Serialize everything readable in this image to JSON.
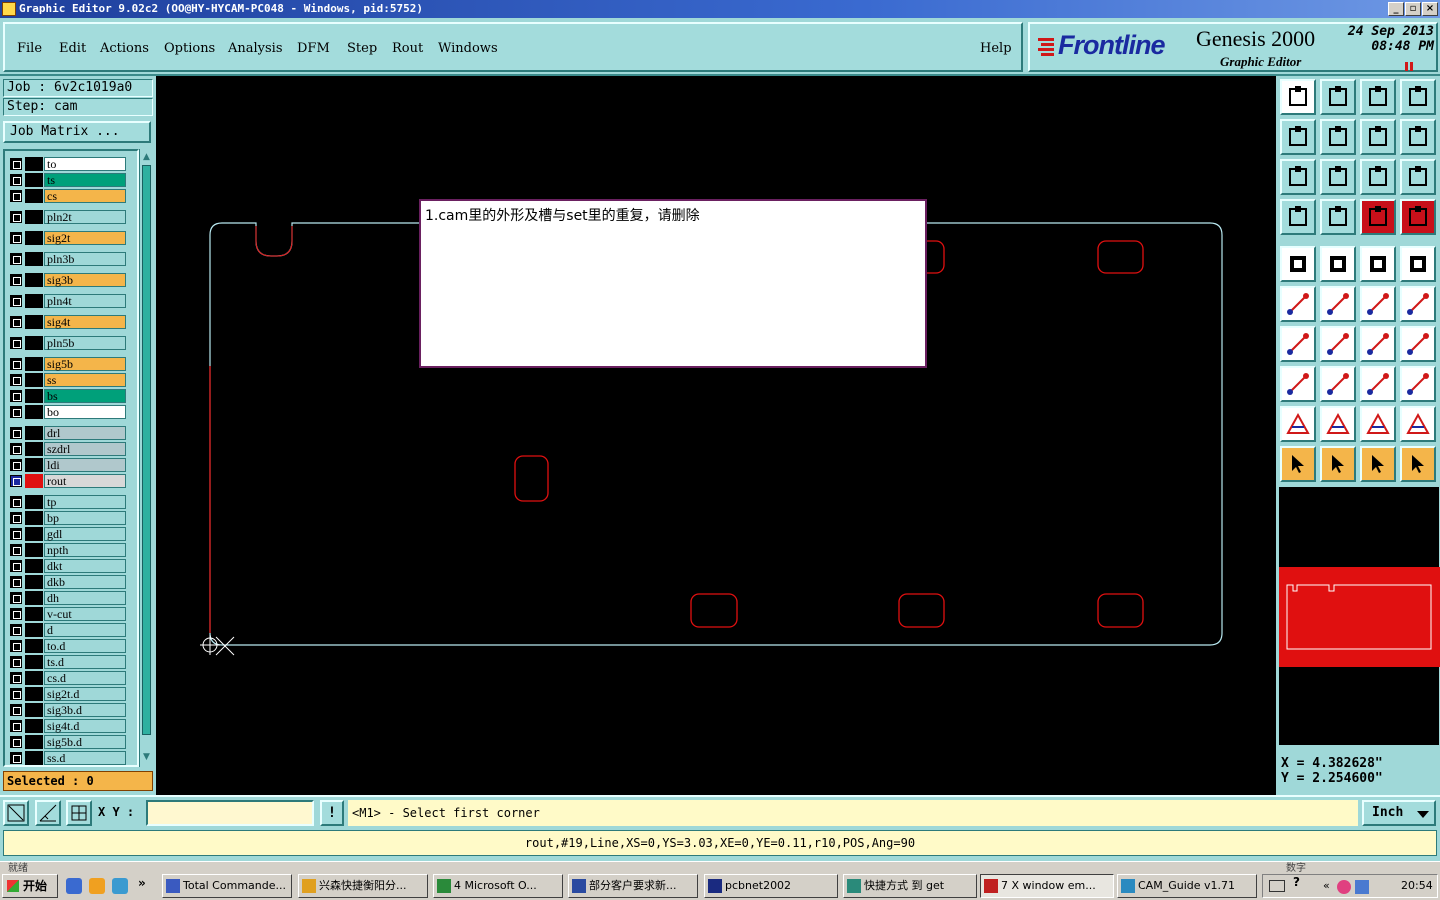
{
  "window": {
    "title": "Graphic Editor 9.02c2  (OO@HY-HYCAM-PC048 - Windows, pid:5752)",
    "min": "_",
    "max": "▫",
    "close": "×"
  },
  "menu": {
    "items": [
      "File",
      "Edit",
      "Actions",
      "Options",
      "Analysis",
      "DFM",
      "Step",
      "Rout",
      "Windows"
    ],
    "help": "Help"
  },
  "brand": {
    "logo": "Frontline",
    "product": "Genesis 2000",
    "subtitle": "Graphic Editor",
    "date_line1": "24  Sep  2013",
    "date_line2": "08:48  PM"
  },
  "job": {
    "job_label": "Job  :  6v2c1019a0",
    "step_label": "Step:  cam",
    "matrix_button": "Job Matrix ..."
  },
  "layers": [
    {
      "name": "to",
      "color": "#ffffff",
      "swatch": "#000000"
    },
    {
      "name": "ts",
      "color": "#00a07a",
      "swatch": "#000000"
    },
    {
      "name": "cs",
      "color": "#f4b54a",
      "swatch": "#000000"
    },
    {
      "name": "pln2t",
      "color": "#9fd8d8",
      "swatch": "#000000"
    },
    {
      "name": "sig2t",
      "color": "#f4b54a",
      "swatch": "#000000"
    },
    {
      "name": "pln3b",
      "color": "#9fd8d8",
      "swatch": "#000000"
    },
    {
      "name": "sig3b",
      "color": "#f4b54a",
      "swatch": "#000000"
    },
    {
      "name": "pln4t",
      "color": "#9fd8d8",
      "swatch": "#000000"
    },
    {
      "name": "sig4t",
      "color": "#f4b54a",
      "swatch": "#000000"
    },
    {
      "name": "pln5b",
      "color": "#9fd8d8",
      "swatch": "#000000"
    },
    {
      "name": "sig5b",
      "color": "#f4b54a",
      "swatch": "#000000"
    },
    {
      "name": "ss",
      "color": "#f4b54a",
      "swatch": "#000000"
    },
    {
      "name": "bs",
      "color": "#00a07a",
      "swatch": "#000000"
    },
    {
      "name": "bo",
      "color": "#ffffff",
      "swatch": "#000000"
    },
    {
      "name": "drl",
      "color": "#b0c8cc",
      "swatch": "#000000"
    },
    {
      "name": "szdrl",
      "color": "#b0c8cc",
      "swatch": "#000000"
    },
    {
      "name": "ldi",
      "color": "#b0c8cc",
      "swatch": "#000000"
    },
    {
      "name": "rout",
      "color": "#d8d8d8",
      "swatch": "#e01010"
    },
    {
      "name": "tp",
      "color": "#9fd8d8",
      "swatch": "#000000"
    },
    {
      "name": "bp",
      "color": "#9fd8d8",
      "swatch": "#000000"
    },
    {
      "name": "gdl",
      "color": "#9fd8d8",
      "swatch": "#000000"
    },
    {
      "name": "npth",
      "color": "#9fd8d8",
      "swatch": "#000000"
    },
    {
      "name": "dkt",
      "color": "#9fd8d8",
      "swatch": "#000000"
    },
    {
      "name": "dkb",
      "color": "#9fd8d8",
      "swatch": "#000000"
    },
    {
      "name": "dh",
      "color": "#9fd8d8",
      "swatch": "#000000"
    },
    {
      "name": "v-cut",
      "color": "#9fd8d8",
      "swatch": "#000000"
    },
    {
      "name": "d",
      "color": "#9fd8d8",
      "swatch": "#000000"
    },
    {
      "name": "to.d",
      "color": "#9fd8d8",
      "swatch": "#000000"
    },
    {
      "name": "ts.d",
      "color": "#9fd8d8",
      "swatch": "#000000"
    },
    {
      "name": "cs.d",
      "color": "#9fd8d8",
      "swatch": "#000000"
    },
    {
      "name": "sig2t.d",
      "color": "#9fd8d8",
      "swatch": "#000000"
    },
    {
      "name": "sig3b.d",
      "color": "#9fd8d8",
      "swatch": "#000000"
    },
    {
      "name": "sig4t.d",
      "color": "#9fd8d8",
      "swatch": "#000000"
    },
    {
      "name": "sig5b.d",
      "color": "#9fd8d8",
      "swatch": "#000000"
    },
    {
      "name": "ss.d",
      "color": "#9fd8d8",
      "swatch": "#000000"
    }
  ],
  "selected": "Selected : 0",
  "popup": {
    "text": "1.cam里的外形及槽与set里的重复，请删除"
  },
  "coords": {
    "x": "X = 4.382628\"",
    "y": "Y = 2.254600\""
  },
  "command": {
    "xy_label": "X Y :",
    "prompt": "<M1> - Select first corner",
    "unit": "Inch",
    "excl": "!"
  },
  "status": "rout,#19,Line,XS=0,YS=3.03,XE=0,YE=0.11,r10,POS,Ang=90",
  "taskbar": {
    "left_hint": "就绪",
    "right_hint": "数字",
    "start": "开始",
    "tasks": [
      "Total Commande...",
      "兴森快捷衡阳分...",
      "4 Microsoft O...",
      "部分客户要求新...",
      "pcbnet2002",
      "快捷方式 到 get",
      "7 X window em...",
      "CAM_Guide v1.71"
    ],
    "clock": "20:54"
  },
  "colors": {
    "accent_teal": "#9fd8d8",
    "rout_red": "#e01010",
    "profile_cyan": "#b8e8f0"
  }
}
